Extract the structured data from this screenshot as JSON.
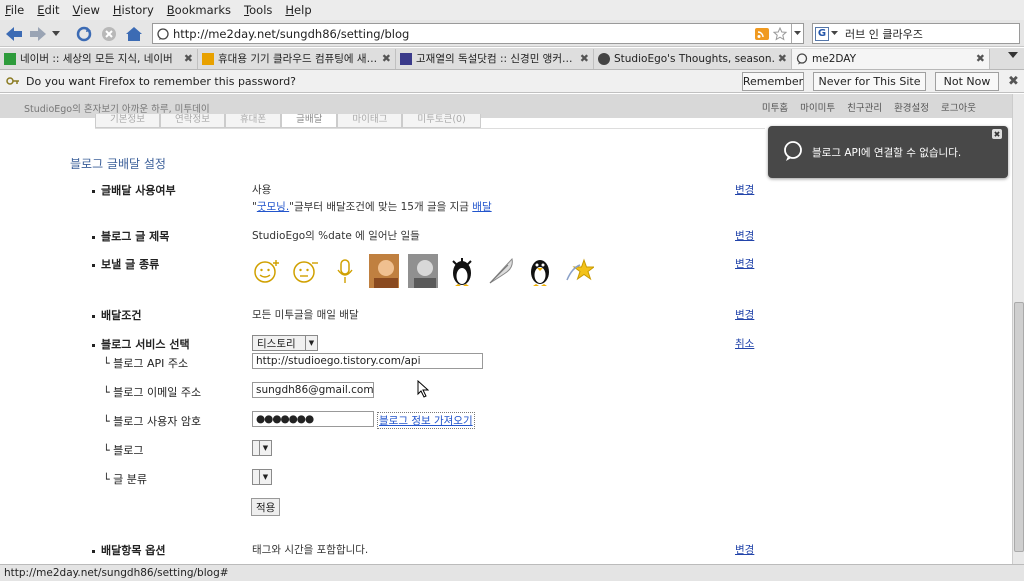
{
  "menu": [
    "File",
    "Edit",
    "View",
    "History",
    "Bookmarks",
    "Tools",
    "Help"
  ],
  "urlbar": {
    "url": "http://me2day.net/sungdh86/setting/blog"
  },
  "search": {
    "engine_label": "G",
    "query": "러브 인 클라우즈"
  },
  "tabs": [
    {
      "label": "네이버 :: 세상의 모든 지식, 네이버",
      "fav": "#2e9c3c"
    },
    {
      "label": "휴대용 기기 클라우드 컴퓨팅에 새…",
      "fav": "#e8a100"
    },
    {
      "label": "고재열의 독설닷컴 :: 신경민 앵커…",
      "fav": "#3a3a8a"
    },
    {
      "label": "StudioEgo's Thoughts, season…",
      "fav": "#444444"
    },
    {
      "label": "me2DAY",
      "fav": "#555555"
    }
  ],
  "notification": {
    "message": "Do you want Firefox to remember this password?",
    "remember": "Remember",
    "never": "Never for This Site",
    "not_now": "Not Now"
  },
  "site_header": {
    "left": "StudioEgo의 혼자보기 아까운 하루, 미투데이",
    "nav": [
      "미투홈",
      "마이미투",
      "친구관리",
      "환경설정",
      "로그아웃"
    ]
  },
  "subtabs": [
    "기본정보",
    "연락정보",
    "휴대폰",
    "글배달",
    "마이태그",
    "미투토큰(0)"
  ],
  "section_title": "블로그 글배달 설정",
  "rows": {
    "usage": {
      "label": "글배달 사용여부",
      "value": "사용",
      "detail_pre": "\"",
      "detail_link": "굿모닝.",
      "detail_mid": "\"글부터 배달조건에 맞는 15개 글을 지금 ",
      "detail_link2": "배달",
      "edit": "변경"
    },
    "title": {
      "label": "블로그 글 제목",
      "value": "StudioEgo의 %date 에 일어난 일들",
      "edit": "변경"
    },
    "types": {
      "label": "보낼 글 종류",
      "edit": "변경"
    },
    "condition": {
      "label": "배달조건",
      "value": "모든 미투글을 매일 배달",
      "edit": "변경"
    },
    "service": {
      "label": "블로그 서비스 선택",
      "selected": "티스토리",
      "cancel": "취소"
    },
    "api": {
      "label": "└ 블로그 API 주소",
      "value": "http://studioego.tistory.com/api"
    },
    "email": {
      "label": "└ 블로그 이메일 주소",
      "value": "sungdh86@gmail.com"
    },
    "password": {
      "label": "└ 블로그 사용자 암호",
      "value": "●●●●●●●",
      "fetch": "블로그 정보 가져오기"
    },
    "blog": {
      "label": "└ 블로그"
    },
    "category": {
      "label": "└ 글 분류"
    },
    "apply": "적용",
    "options": {
      "label": "배달항목 옵션",
      "value": "태그와 시간을 포함합니다.",
      "edit": "변경"
    }
  },
  "toast": {
    "message": "블로그 API에 연결할 수 없습니다."
  },
  "status": "http://me2day.net/sungdh86/setting/blog#",
  "colors": {
    "accent": "#3b5f99",
    "link": "#2244aa",
    "toast_bg": "#484848"
  }
}
